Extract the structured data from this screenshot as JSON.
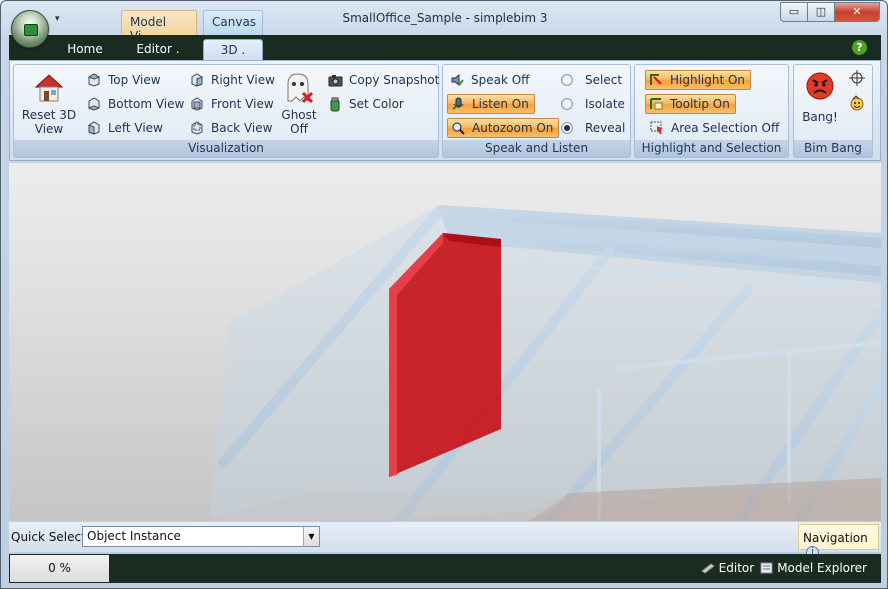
{
  "window": {
    "title": "SmallOffice_Sample - simplebim 3",
    "minimize": "▭",
    "maximize": "◫",
    "close": "✕"
  },
  "quick_access_arrow": "▾",
  "context_tabs": [
    "Model Vi...",
    "Canvas"
  ],
  "tabs": [
    {
      "label": "Home"
    },
    {
      "label": "Editor   ."
    },
    {
      "label": "3D   ."
    }
  ],
  "help_label": "?",
  "ribbon": {
    "visualization": {
      "caption": "Visualization",
      "reset": "Reset 3D View",
      "reset_l1": "Reset 3D",
      "reset_l2": "View",
      "top": "Top View",
      "bottom": "Bottom View",
      "left": "Left View",
      "right": "Right View",
      "front": "Front View",
      "back": "Back View",
      "ghost_l1": "Ghost",
      "ghost_l2": "Off",
      "copy": "Copy Snapshot",
      "setcolor": "Set Color"
    },
    "speak": {
      "caption": "Speak and Listen",
      "speak_off": "Speak Off",
      "listen_on": "Listen On",
      "autozoom_on": "Autozoom On",
      "select": "Select",
      "isolate": "Isolate",
      "reveal": "Reveal",
      "selected_mode": "Reveal"
    },
    "highlight": {
      "caption": "Highlight and Selection",
      "highlight_on": "Highlight On",
      "tooltip_on": "Tooltip On",
      "area_sel": "Area Selection Off"
    },
    "bimbang": {
      "caption": "Bim Bang",
      "bang": "Bang!"
    }
  },
  "quick_select": {
    "label": "Quick Select:",
    "value": "Object Instance",
    "arrow": "▼"
  },
  "navigation_label": "Navigation",
  "info_glyph": "i",
  "progress": "0 %",
  "status_right": {
    "editor": "Editor",
    "explorer": "Model Explorer"
  },
  "colors": {
    "highlight": "#f5a23b",
    "selected_object": "#c8141c",
    "status_bar": "#1a2b1f"
  }
}
